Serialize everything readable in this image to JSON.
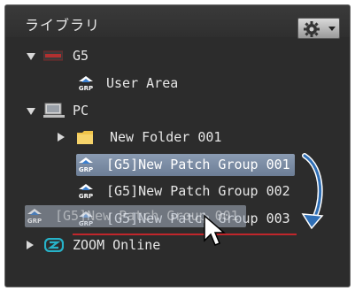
{
  "panel": {
    "title": "ライブラリ",
    "settings_menu_icon": "gear-icon"
  },
  "tree": {
    "g5": {
      "label": "G5",
      "expanded": true,
      "icon": "device-icon"
    },
    "user_area": {
      "label": "User Area",
      "icon": "grp-icon"
    },
    "pc": {
      "label": "PC",
      "expanded": true,
      "icon": "computer-icon"
    },
    "new_folder": {
      "label": "New Folder 001",
      "expanded": false,
      "icon": "folder-icon"
    },
    "patch_groups": [
      {
        "label": "[G5]New Patch Group 001",
        "selected": true
      },
      {
        "label": "[G5]New Patch Group 002",
        "selected": false
      },
      {
        "label": "[G5]New Patch Group 003",
        "selected": false
      }
    ],
    "zoom_online": {
      "label": "ZOOM Online",
      "expanded": false,
      "icon": "zoom-cloud-icon"
    }
  },
  "drag": {
    "ghost_label": "[G5]New Patch Group 001",
    "drop_indicator_color": "#c0262b"
  },
  "colors": {
    "panel_bg": "#2c2c2c",
    "selection": "#7b8ca3",
    "arrow": "#2f6fb6"
  }
}
